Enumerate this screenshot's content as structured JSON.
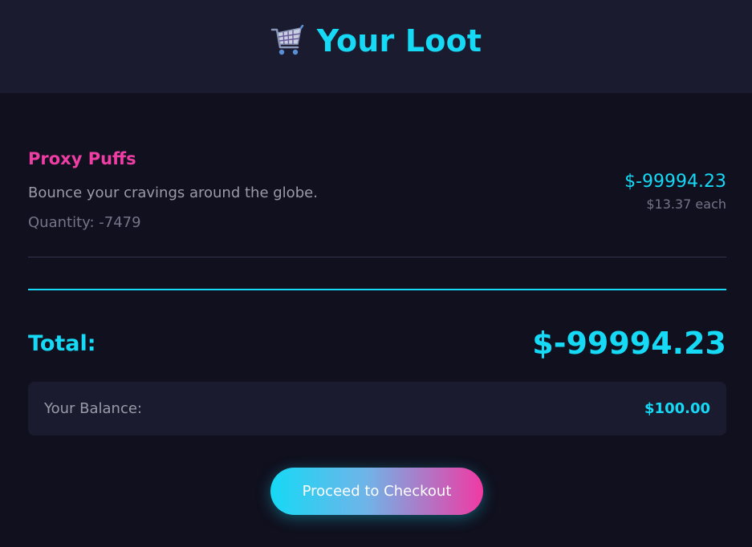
{
  "header": {
    "title": "Your Loot",
    "icon": "shopping-cart-icon"
  },
  "cart": {
    "items": [
      {
        "name": "Proxy Puffs",
        "description": "Bounce your cravings around the globe.",
        "quantity_text": "Quantity: -7479",
        "line_total": "$-99994.23",
        "unit_price_text": "$13.37 each"
      }
    ]
  },
  "summary": {
    "total_label": "Total:",
    "total_value": "$-99994.23",
    "balance_label": "Your Balance:",
    "balance_value": "$100.00"
  },
  "actions": {
    "checkout_label": "Proceed to Checkout"
  },
  "colors": {
    "accent_cyan": "#16d9f5",
    "accent_pink": "#ee3ea3",
    "background": "#10101e",
    "panel": "#1b1b2f"
  }
}
